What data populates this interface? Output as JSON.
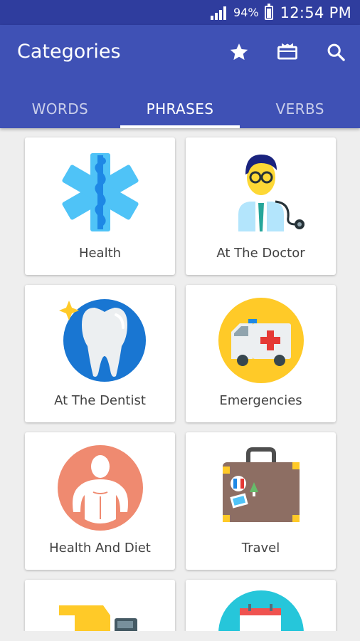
{
  "status_bar": {
    "battery": "94%",
    "time": "12:54 PM"
  },
  "app_bar": {
    "title": "Categories",
    "icons": [
      "star-icon",
      "ticket-icon",
      "search-icon"
    ]
  },
  "tabs": [
    {
      "label": "WORDS",
      "selected": false
    },
    {
      "label": "PHRASES",
      "selected": true
    },
    {
      "label": "VERBS",
      "selected": false
    }
  ],
  "categories": [
    {
      "label": "Health",
      "icon": "health-icon"
    },
    {
      "label": "At The Doctor",
      "icon": "doctor-icon"
    },
    {
      "label": "At The Dentist",
      "icon": "tooth-icon"
    },
    {
      "label": "Emergencies",
      "icon": "ambulance-icon"
    },
    {
      "label": "Health And Diet",
      "icon": "body-icon"
    },
    {
      "label": "Travel",
      "icon": "suitcase-icon"
    },
    {
      "label": "",
      "icon": "truck-icon"
    },
    {
      "label": "",
      "icon": "calendar-icon"
    }
  ],
  "colors": {
    "status_bar": "#2f3d9e",
    "app_bar": "#3f51b5",
    "background": "#eeeeee"
  }
}
